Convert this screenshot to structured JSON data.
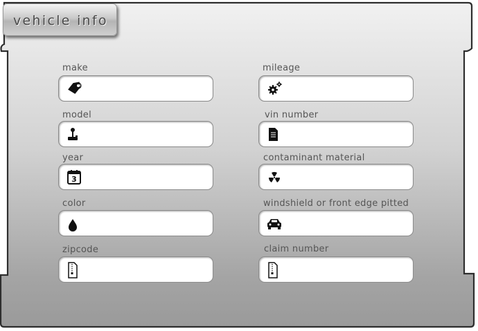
{
  "section": {
    "title": "vehicle info"
  },
  "fields": [
    {
      "label": "make",
      "icon": "tag-icon",
      "value": ""
    },
    {
      "label": "model",
      "icon": "joystick-icon",
      "value": ""
    },
    {
      "label": "year",
      "icon": "calendar-icon",
      "value": "",
      "icon_text": "3"
    },
    {
      "label": "color",
      "icon": "drop-icon",
      "value": ""
    },
    {
      "label": "zipcode",
      "icon": "zip-file-icon",
      "value": ""
    },
    {
      "label": "mileage",
      "icon": "gears-icon",
      "value": ""
    },
    {
      "label": "vin number",
      "icon": "document-icon",
      "value": ""
    },
    {
      "label": "contaminant material",
      "icon": "radiation-icon",
      "value": ""
    },
    {
      "label": "windshield or front edge pitted",
      "icon": "car-icon",
      "value": ""
    },
    {
      "label": "claim number",
      "icon": "zip-file-icon",
      "value": ""
    }
  ]
}
